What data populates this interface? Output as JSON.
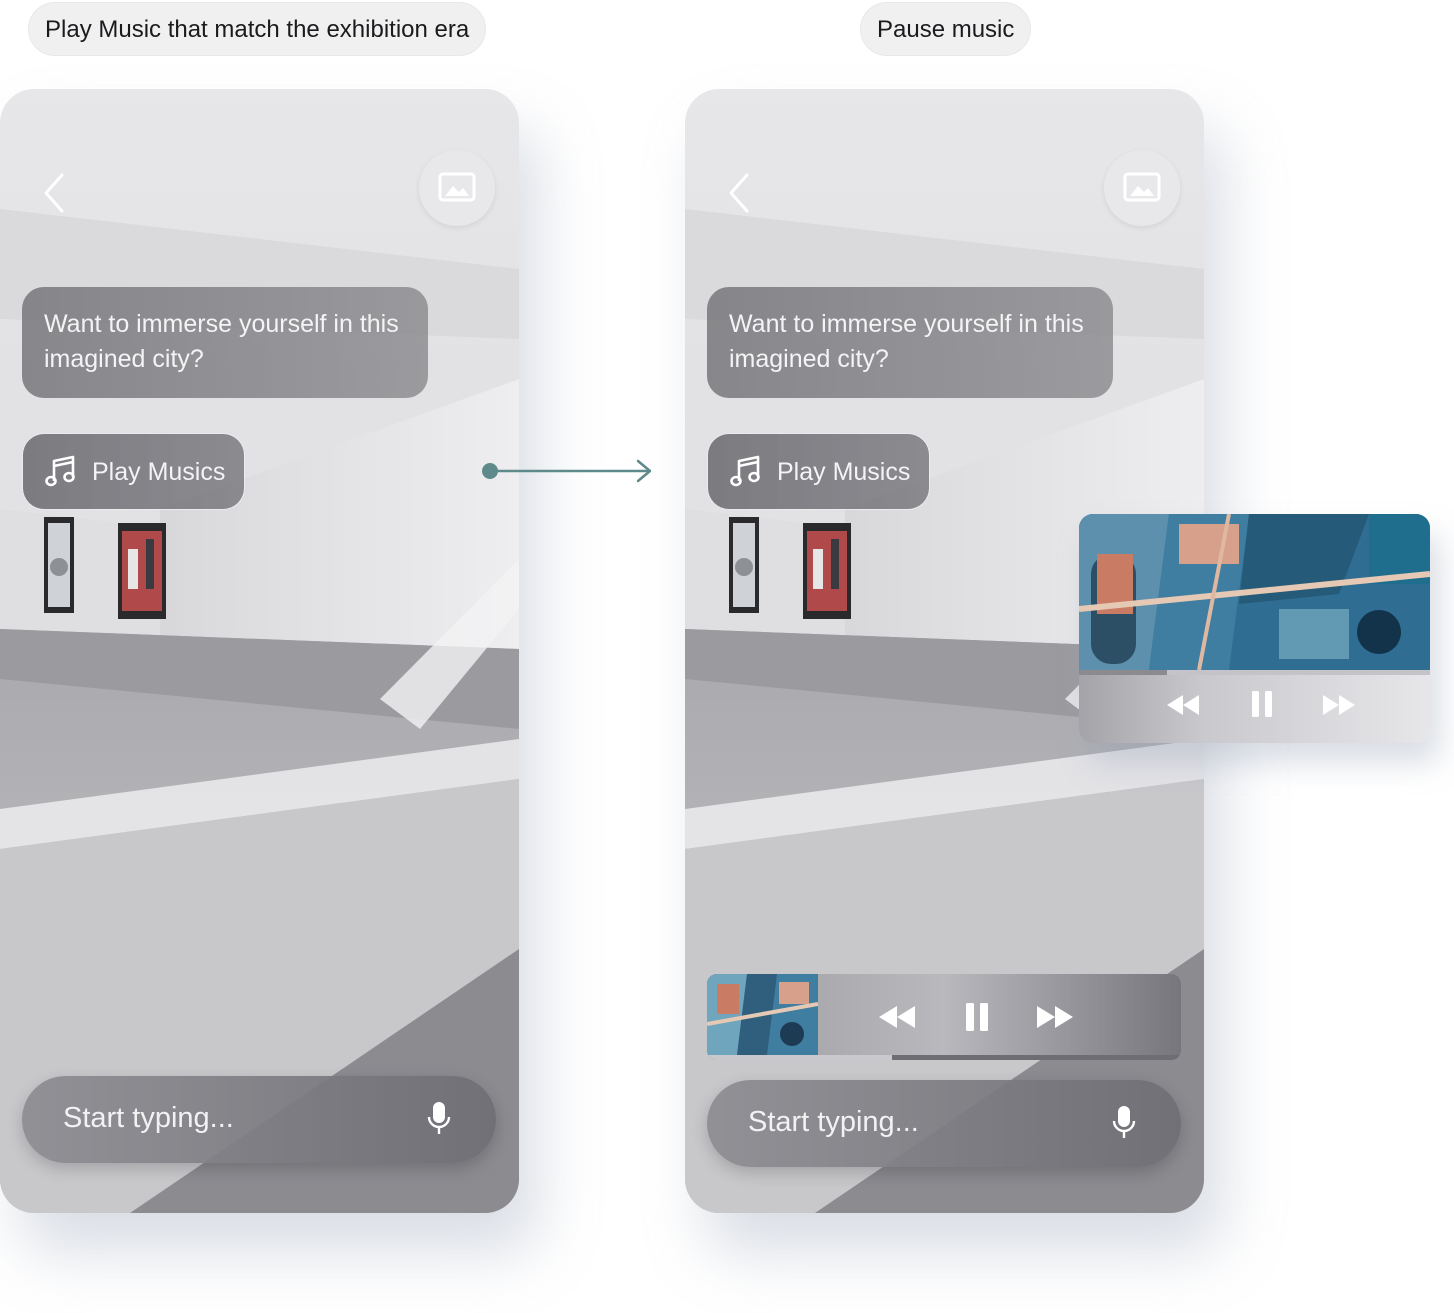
{
  "steps": [
    {
      "caption": "Play Music that match the exhibition era",
      "screen": {
        "message": "Want to immerse yourself in this imagined city?",
        "action_button": "Play Musics",
        "input_placeholder": "Start typing..."
      }
    },
    {
      "caption": "Pause music",
      "screen": {
        "message": "Want to immerse yourself in this imagined city?",
        "action_button": "Play Musics",
        "input_placeholder": "Start typing..."
      },
      "player": {
        "state": "playing",
        "progress_fraction": 0.25,
        "controls": [
          "rewind-icon",
          "pause-icon",
          "fast-forward-icon"
        ]
      },
      "mini_player": {
        "state": "playing",
        "progress_fraction": 0.39,
        "controls": [
          "rewind-icon",
          "pause-icon",
          "fast-forward-icon"
        ]
      }
    }
  ],
  "icons": {
    "back": "chevron-left-icon",
    "gallery": "image-icon",
    "music": "music-note-icon",
    "mic": "microphone-icon",
    "connector": "arrow-right-icon"
  },
  "colors": {
    "accent": "#5f8a8b",
    "bubble": "#7a7a7e",
    "caption_bg": "#f0f0f1"
  }
}
